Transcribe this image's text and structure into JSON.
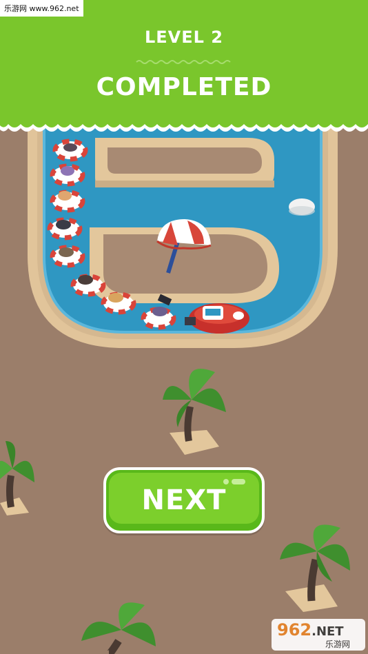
{
  "header": {
    "level_label": "LEVEL 2",
    "status_label": "COMPLETED"
  },
  "buttons": {
    "next_label": "NEXT"
  },
  "watermarks": {
    "top_left": "乐游网 www.962.net",
    "bottom_right_main": "962",
    "bottom_right_net": ".NET",
    "bottom_right_sub": "乐游网"
  },
  "colors": {
    "banner_green": "#7ac62c",
    "sand": "#e3c79c",
    "ground": "#9b7e6a",
    "water": "#2f97c2",
    "button_green": "#7ccf2c",
    "palm_green": "#3f8f2e"
  },
  "icons": [
    "umbrella-icon",
    "rescue-boat-icon",
    "swim-ring-icon",
    "palm-tree-icon",
    "rock-icon"
  ]
}
